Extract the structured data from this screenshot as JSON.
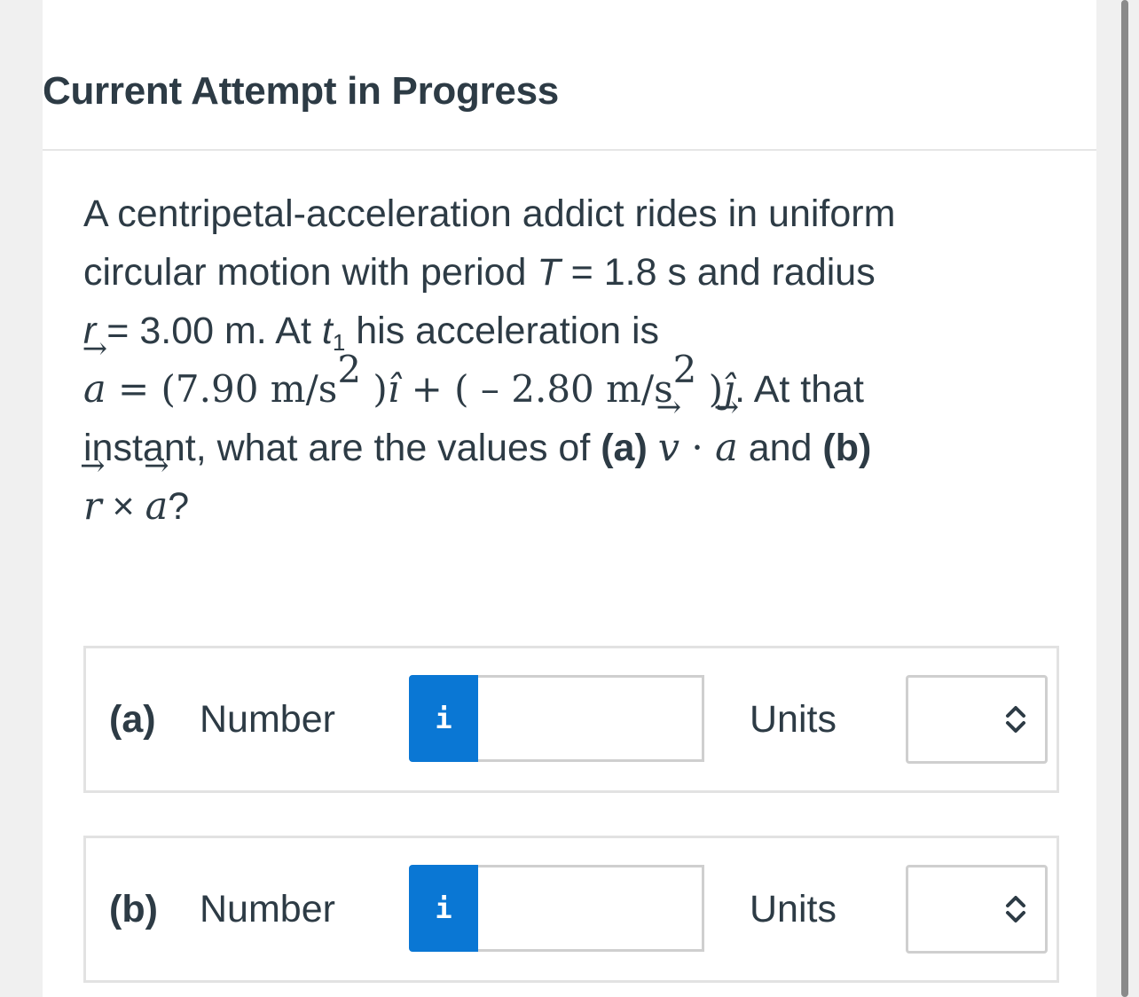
{
  "header": {
    "title": "Current Attempt in Progress"
  },
  "question": {
    "line1": "A centripetal-acceleration addict rides in uniform",
    "line2_pre": "circular motion with period ",
    "T_symbol": "T",
    "line2_post": " = 1.8 s and radius",
    "r_symbol": "r",
    "line3_mid": " = 3.00 m. At ",
    "t_symbol": "t",
    "t_sub": "1",
    "line3_post": " his acceleration is",
    "a_symbol": "a",
    "eq_equals": " = ",
    "eq_part1": "(7.90 m/s",
    "sq": "2",
    "eq_part1_close": " )",
    "i_hat": "î",
    "eq_plus": " + ( – 2.80 m/s",
    "eq_part2_close": " )",
    "j_hat": "ĵ",
    "eq_tail": ". At that",
    "line5_pre": "instant, what are the values of ",
    "part_a": "(a)",
    "v_symbol": "v",
    "dot": " · ",
    "and": " and ",
    "part_b": "(b)",
    "cross": " × ",
    "question_mark": "?",
    "arrow": "→"
  },
  "answers": [
    {
      "label": "(a)",
      "number_label": "Number",
      "info": "i",
      "value": "",
      "units_label": "Units",
      "units_value": ""
    },
    {
      "label": "(b)",
      "number_label": "Number",
      "info": "i",
      "value": "",
      "units_label": "Units",
      "units_value": ""
    }
  ],
  "colors": {
    "accent": "#0a77d4",
    "text": "#2d3b45",
    "border": "#e2e2e2"
  }
}
